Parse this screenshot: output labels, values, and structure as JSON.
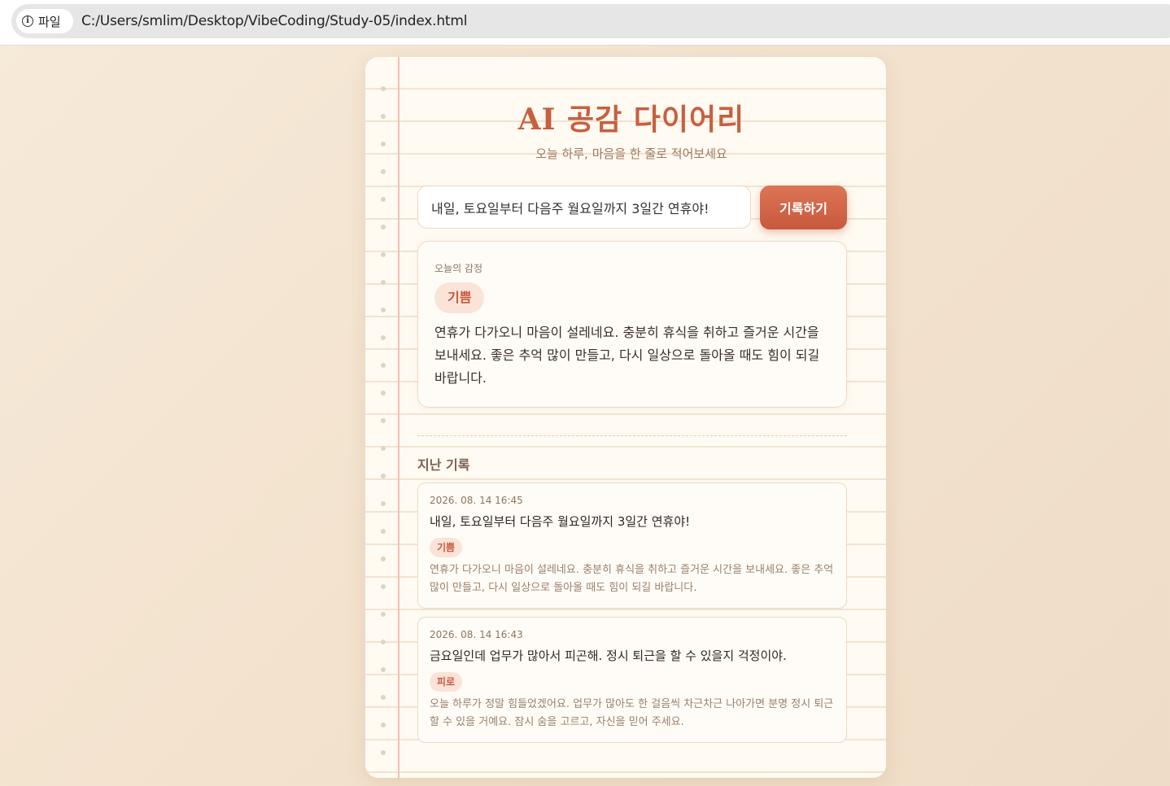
{
  "browser": {
    "chip_label": "파일",
    "url": "C:/Users/smlim/Desktop/VibeCoding/Study-05/index.html"
  },
  "app": {
    "title": "AI 공감 다이어리",
    "subtitle": "오늘 하루, 마음을 한 줄로 적어보세요"
  },
  "input": {
    "value": "내일, 토요일부터 다음주 월요일까지 3일간 연휴야!",
    "button_label": "기록하기"
  },
  "result": {
    "label": "오늘의 감정",
    "emotion": "기쁨",
    "message": "연휴가 다가오니 마음이 설레네요. 충분히 휴식을 취하고 즐거운 시간을 보내세요. 좋은 추억 많이 만들고, 다시 일상으로 돌아올 때도 힘이 되길 바랍니다."
  },
  "history": {
    "title": "지난 기록",
    "entries": [
      {
        "date": "2026. 08. 14 16:45",
        "text": "내일, 토요일부터 다음주 월요일까지 3일간 연휴야!",
        "emotion": "기쁨",
        "reply": "연휴가 다가오니 마음이 설레네요. 충분히 휴식을 취하고 즐거운 시간을 보내세요. 좋은 추억 많이 만들고, 다시 일상으로 돌아올 때도 힘이 되길 바랍니다."
      },
      {
        "date": "2026. 08. 14 16:43",
        "text": "금요일인데 업무가 많아서 피곤해. 정시 퇴근을 할 수 있을지 걱정이야.",
        "emotion": "피로",
        "reply": "오늘 하루가 정말 힘들었겠어요. 업무가 많아도 한 걸음씩 차근차근 나아가면 분명 정시 퇴근할 수 있을 거예요. 잠시 숨을 고르고, 자신을 믿어 주세요."
      }
    ]
  }
}
